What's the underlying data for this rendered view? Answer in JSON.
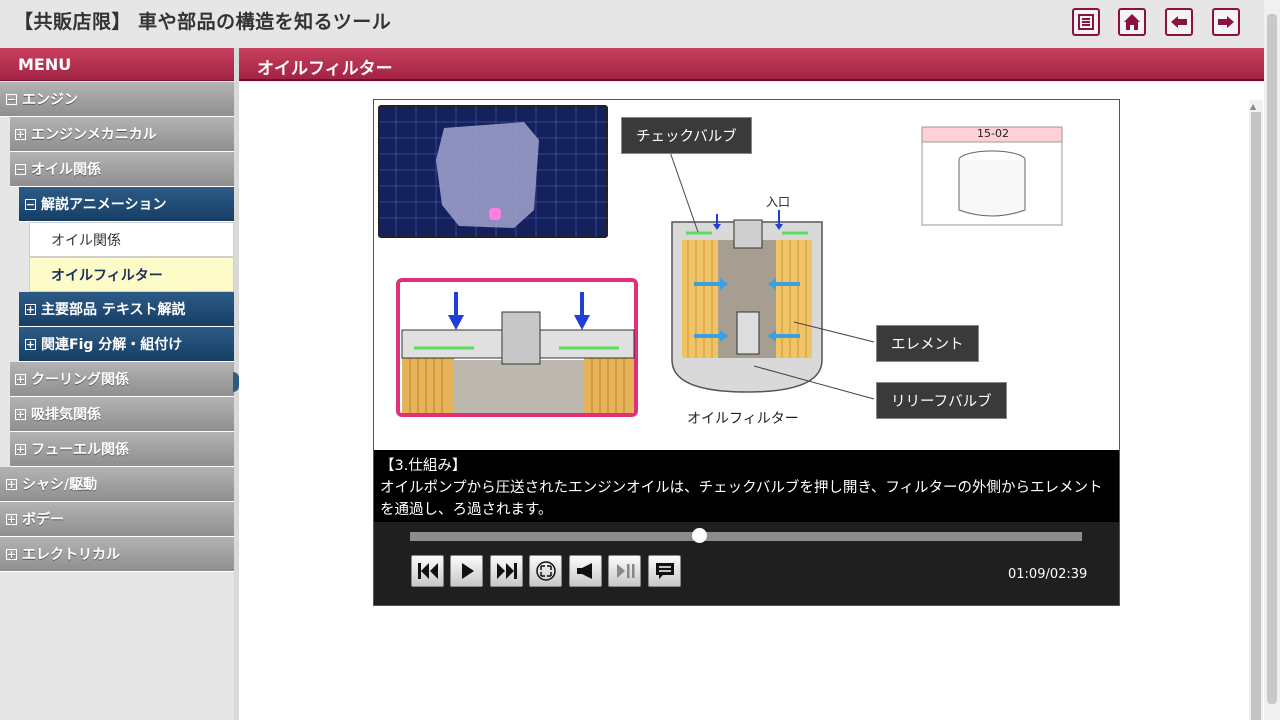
{
  "header": {
    "title": "【共販店限】 車や部品の構造を知るツール",
    "buttons": [
      "index-button",
      "home-button",
      "back-button",
      "forward-button"
    ]
  },
  "sidebar": {
    "title": "MENU",
    "items": [
      {
        "label": "エンジン",
        "expander": "−"
      },
      {
        "label": "エンジンメカニカル",
        "expander": "+"
      },
      {
        "label": "オイル関係",
        "expander": "−"
      },
      {
        "label": "解説アニメーション",
        "expander": "−"
      },
      {
        "label": "オイル関係"
      },
      {
        "label": "オイルフィルター"
      },
      {
        "label": "主要部品 テキスト解説",
        "expander": "+"
      },
      {
        "label": "関連Fig 分解・組付け",
        "expander": "+"
      },
      {
        "label": "クーリング関係",
        "expander": "+"
      },
      {
        "label": "吸排気関係",
        "expander": "+"
      },
      {
        "label": "フューエル関係",
        "expander": "+"
      },
      {
        "label": "シャシ/駆動",
        "expander": "+"
      },
      {
        "label": "ボデー",
        "expander": "+"
      },
      {
        "label": "エレクトリカル",
        "expander": "+"
      }
    ]
  },
  "content": {
    "title": "オイルフィルター",
    "diagram": {
      "check_valve_label": "チェックバルブ",
      "inlet_label": "入口",
      "element_label": "エレメント",
      "relief_valve_label": "リリーフバルブ",
      "filter_label": "オイルフィルター",
      "part_number": "15-02"
    },
    "caption": {
      "heading": "【3.仕組み】",
      "body": "オイルポンプから圧送されたエンジンオイルは、チェックバルブを押し開き、フィルターの外側からエレメントを通過し、ろ過されます。"
    },
    "player": {
      "time": "01:09/02:39",
      "progress": 0.43
    }
  },
  "colors": {
    "accent": "#b32c4e",
    "nav_blue": "#1f4a74",
    "highlight": "#fdfbc8"
  }
}
